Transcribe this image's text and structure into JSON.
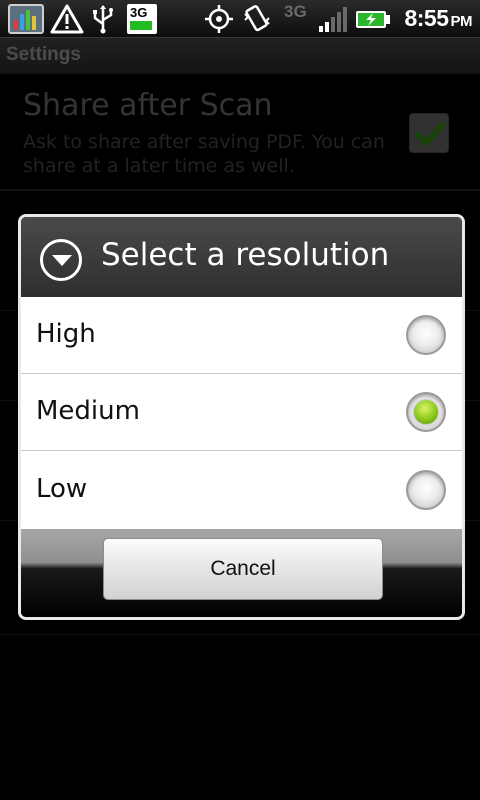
{
  "status_bar": {
    "network_label": "3G",
    "network_label_2": "3G",
    "time": "8:55",
    "ampm": "PM",
    "icons": [
      "app-chart-icon",
      "warning-icon",
      "usb-icon",
      "sim-3g-icon",
      "gps-icon",
      "vibrate-icon",
      "signal-icon",
      "battery-charging-icon"
    ]
  },
  "settings": {
    "title": "Settings",
    "items": [
      {
        "title": "Share after Scan",
        "summary": "Ask to share after saving PDF. You can share at a later time as well.",
        "checked": true
      }
    ]
  },
  "dialog": {
    "title": "Select a resolution",
    "options": [
      {
        "label": "High",
        "selected": false
      },
      {
        "label": "Medium",
        "selected": true
      },
      {
        "label": "Low",
        "selected": false
      }
    ],
    "cancel_label": "Cancel"
  },
  "colors": {
    "accent_green": "#8cc71a",
    "dialog_header": "#3b3b3b"
  }
}
